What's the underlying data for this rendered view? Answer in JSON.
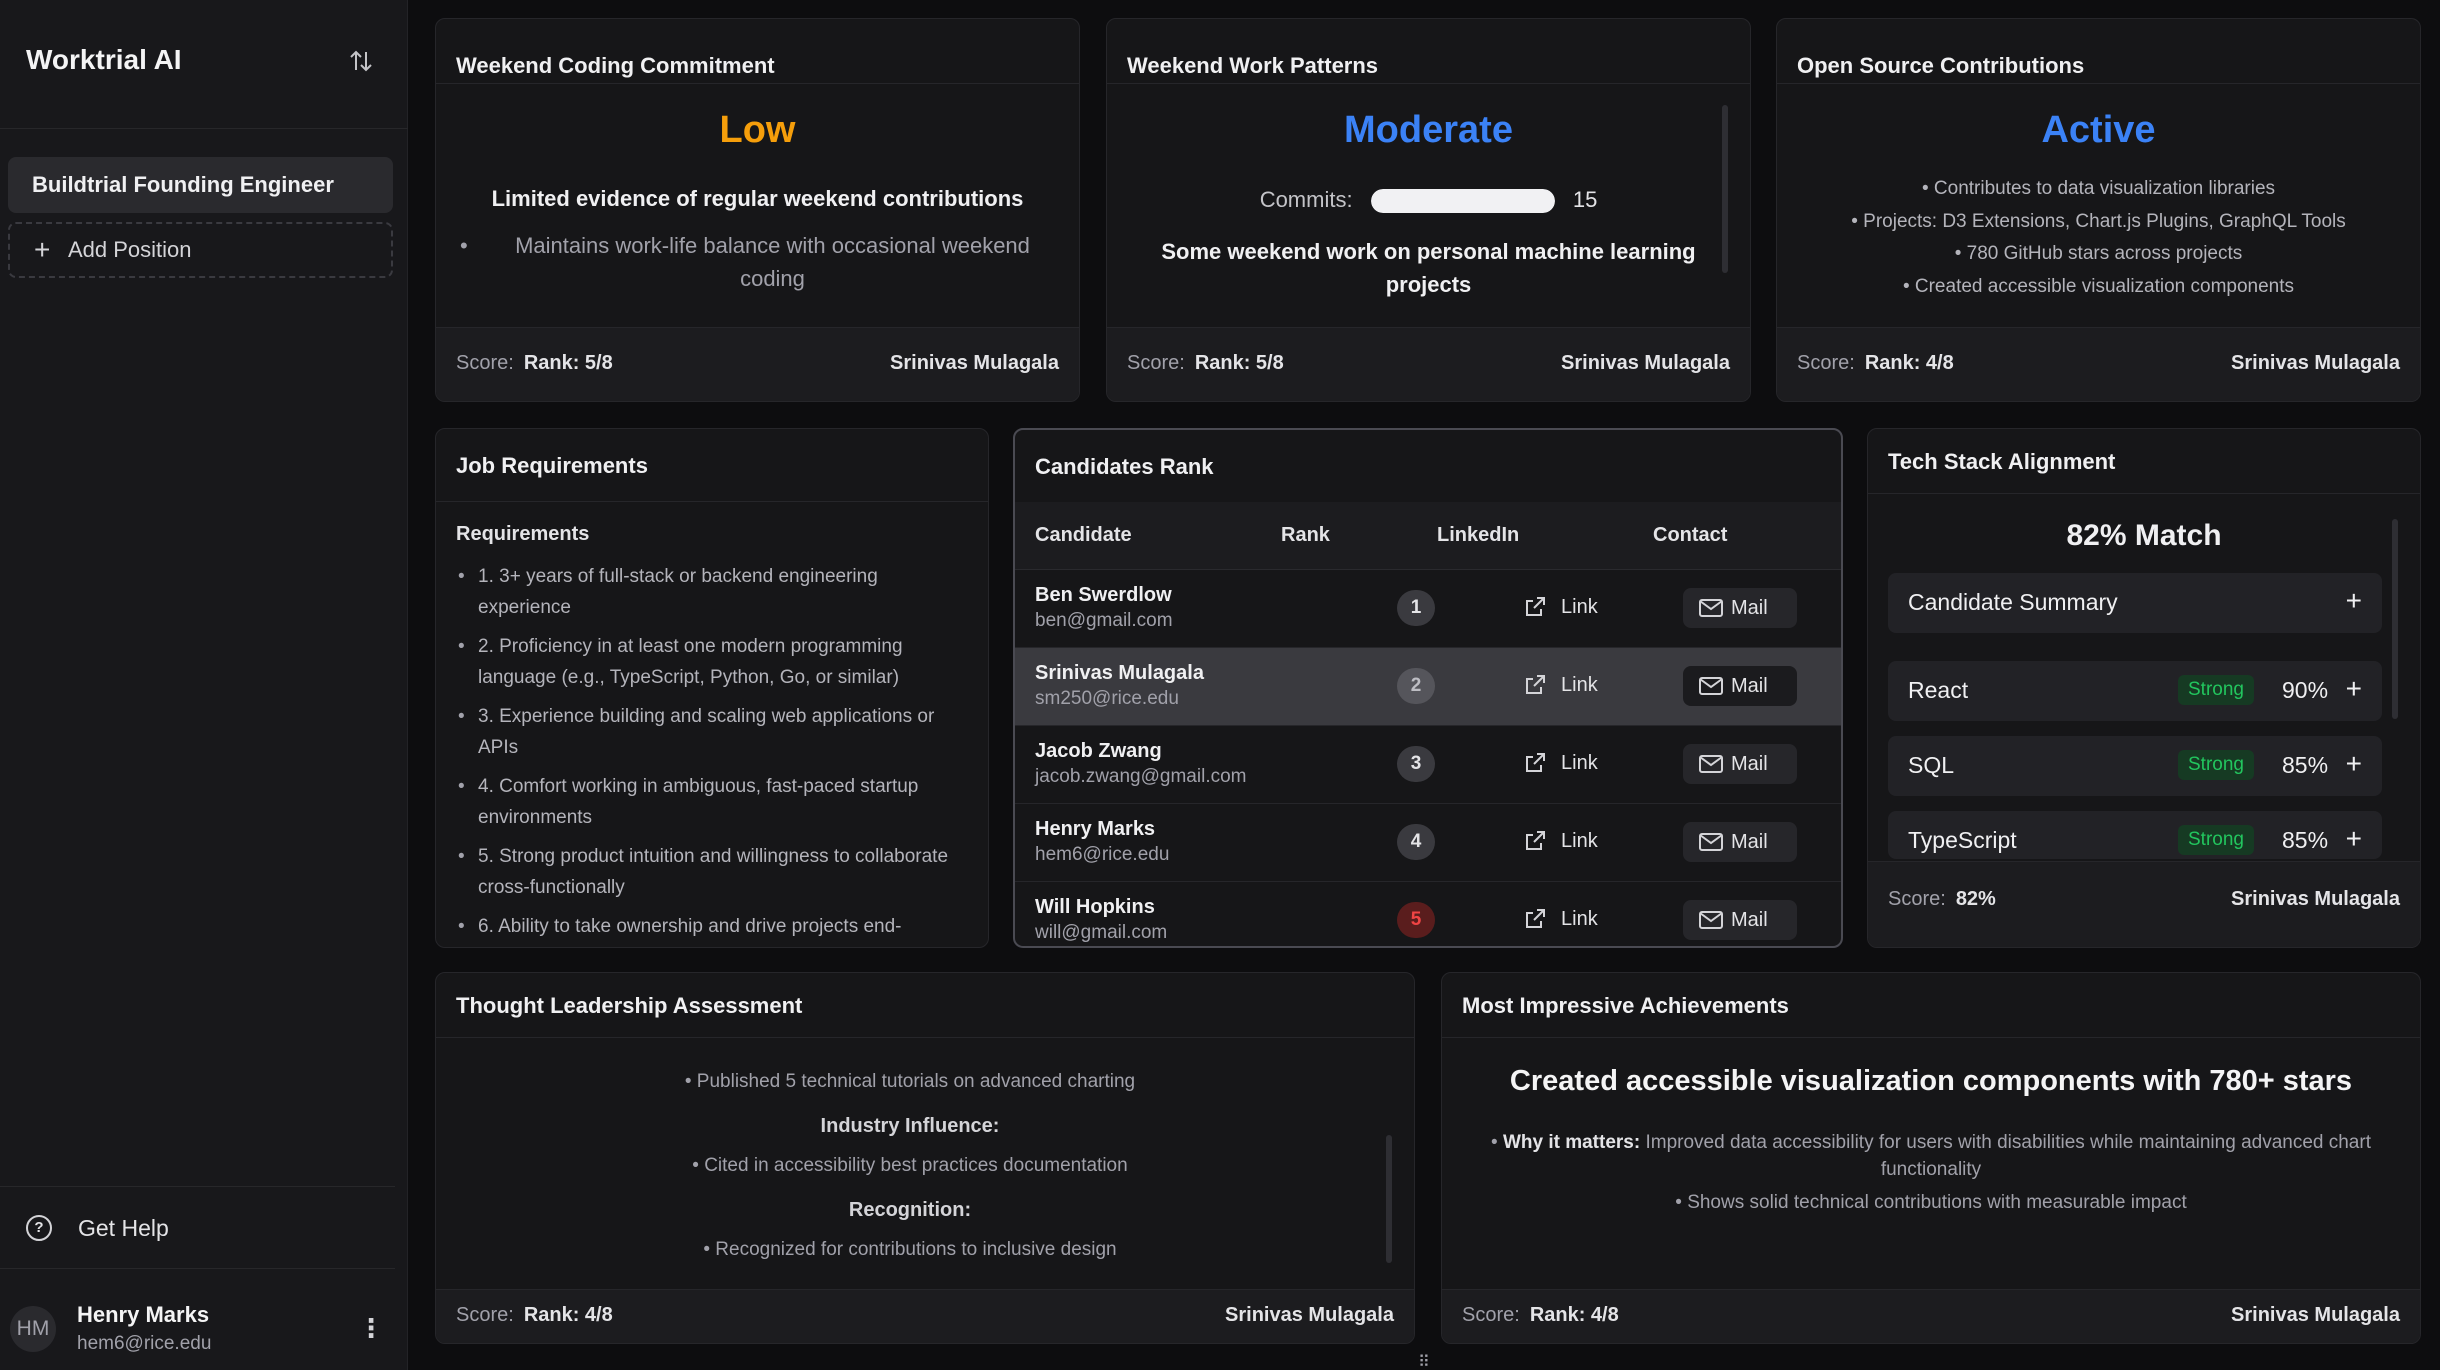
{
  "app": {
    "title": "Worktrial AI"
  },
  "sidebar": {
    "positions": [
      {
        "label": "Buildtrial Founding Engineer"
      }
    ],
    "add_position_label": "Add Position",
    "help_label": "Get Help",
    "user": {
      "initials": "HM",
      "name": "Henry Marks",
      "email": "hem6@rice.edu"
    }
  },
  "cards": {
    "weekend_commitment": {
      "title": "Weekend Coding Commitment",
      "level": "Low",
      "level_color": "#f59e0b",
      "summary": "Limited evidence of regular weekend contributions",
      "bullet": "Maintains work-life balance with occasional weekend coding",
      "score_label": "Score:",
      "rank": "Rank: 5/8",
      "candidate": "Srinivas Mulagala"
    },
    "weekend_patterns": {
      "title": "Weekend Work Patterns",
      "level": "Moderate",
      "level_color": "#3b82f6",
      "commits_label": "Commits:",
      "commits_value": "15",
      "commits_fill_fraction": 1.0,
      "summary": "Some weekend work on personal machine learning projects",
      "score_label": "Score:",
      "rank": "Rank: 5/8",
      "candidate": "Srinivas Mulagala"
    },
    "open_source": {
      "title": "Open Source Contributions",
      "level": "Active",
      "level_color": "#3b82f6",
      "items": [
        "• Contributes to data visualization libraries",
        "• Projects: D3 Extensions, Chart.js Plugins, GraphQL Tools",
        "• 780 GitHub stars across projects",
        "• Created accessible visualization components"
      ],
      "score_label": "Score:",
      "rank": "Rank: 4/8",
      "candidate": "Srinivas Mulagala"
    },
    "job_requirements": {
      "title": "Job Requirements",
      "section_label": "Requirements",
      "items": [
        "1. 3+ years of full-stack or backend engineering experience",
        "2. Proficiency in at least one modern programming language (e.g., TypeScript, Python, Go, or similar)",
        "3. Experience building and scaling web applications or APIs",
        "4. Comfort working in ambiguous, fast-paced startup environments",
        "5. Strong product intuition and willingness to collaborate cross-functionally",
        "6. Ability to take ownership and drive projects end-"
      ]
    },
    "candidates_rank": {
      "title": "Candidates Rank",
      "columns": [
        "Candidate",
        "Rank",
        "LinkedIn",
        "Contact"
      ],
      "link_label": "Link",
      "mail_label": "Mail",
      "rows": [
        {
          "name": "Ben Swerdlow",
          "email": "ben@gmail.com",
          "rank": "1"
        },
        {
          "name": "Srinivas Mulagala",
          "email": "sm250@rice.edu",
          "rank": "2"
        },
        {
          "name": "Jacob Zwang",
          "email": "jacob.zwang@gmail.com",
          "rank": "3"
        },
        {
          "name": "Henry Marks",
          "email": "hem6@rice.edu",
          "rank": "4"
        },
        {
          "name": "Will Hopkins",
          "email": "will@gmail.com",
          "rank": "5"
        }
      ]
    },
    "tech_stack": {
      "title": "Tech Stack Alignment",
      "match": "82% Match",
      "summary_label": "Candidate Summary",
      "skills": [
        {
          "name": "React",
          "badge": "Strong",
          "pct": "90%"
        },
        {
          "name": "SQL",
          "badge": "Strong",
          "pct": "85%"
        },
        {
          "name": "TypeScript",
          "badge": "Strong",
          "pct": "85%"
        }
      ],
      "score_label": "Score:",
      "score_value": "82%",
      "candidate": "Srinivas Mulagala"
    },
    "thought_leadership": {
      "title": "Thought Leadership Assessment",
      "tutorials": "• Published 5 technical tutorials on advanced charting",
      "industry_label": "Industry Influence:",
      "industry_item": "• Cited in accessibility best practices documentation",
      "recognition_label": "Recognition:",
      "recognition_item": "• Recognized for contributions to inclusive design",
      "score_label": "Score:",
      "rank": "Rank: 4/8",
      "candidate": "Srinivas Mulagala"
    },
    "achievements": {
      "title": "Most Impressive Achievements",
      "headline": "Created accessible visualization components with 780+ stars",
      "why_label": "Why it matters:",
      "why_text": "Improved data accessibility for users with disabilities while maintaining advanced chart functionality",
      "impact": "• Shows solid technical contributions with measurable impact",
      "score_label": "Score:",
      "rank": "Rank: 4/8",
      "candidate": "Srinivas Mulagala"
    }
  }
}
